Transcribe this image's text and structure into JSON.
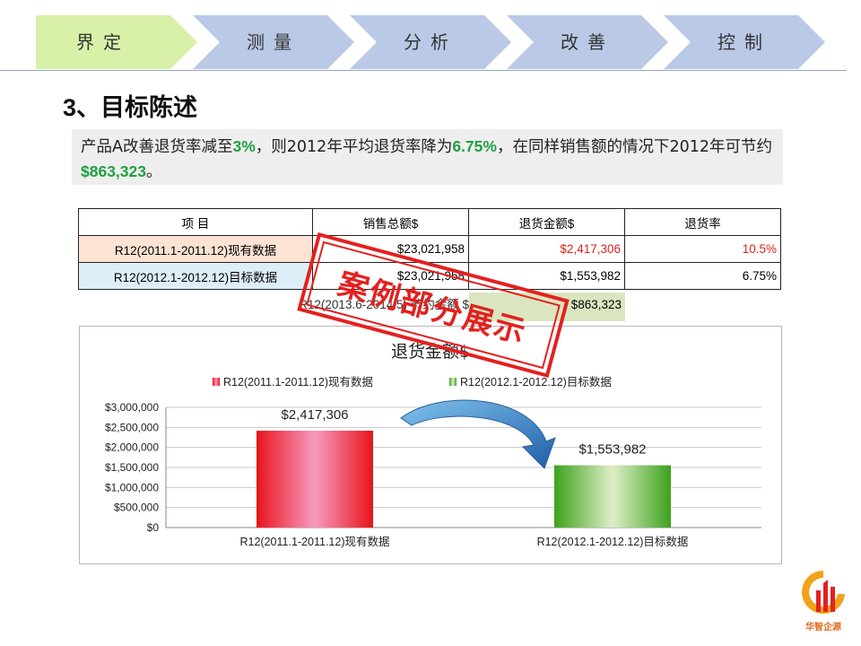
{
  "nav": {
    "steps": [
      "界定",
      "测量",
      "分析",
      "改善",
      "控制"
    ],
    "active_index": 0
  },
  "title": {
    "number": "3",
    "sep": "、",
    "text": "目标陈述"
  },
  "summary": {
    "t1": "产品A改善退货率减至",
    "v1": "3%",
    "t2": "，则2012年平均退货率降为",
    "v2": "6.75%",
    "t3": "，在同样销售额的情况下2012年可节约 ",
    "v3": "$863,323",
    "t4": "。"
  },
  "table": {
    "headers": [
      "项 目",
      "销售总额$",
      "退货金额$",
      "退货率"
    ],
    "rows": [
      {
        "label": "R12(2011.1-2011.12)现有数据",
        "sales": "$23,021,958",
        "returns": "$2,417,306",
        "rate": "10.5%"
      },
      {
        "label": "R12(2012.1-2012.12)目标数据",
        "sales": "$23,021,958",
        "returns": "$1,553,982",
        "rate": "6.75%"
      }
    ],
    "savings_label": "R12(2013.6-2014.5) 节约金额 $",
    "savings_value": "$863,323"
  },
  "stamp": {
    "text": "案例部分展示"
  },
  "logo": {
    "text": "华智企源"
  },
  "colors": {
    "nav_active": "#d8f0a8",
    "nav_inactive": "#b9c9e6",
    "green_highlight": "#21a045",
    "red_value": "#e0201a",
    "stamp": "#e3211f"
  },
  "chart_data": {
    "type": "bar",
    "title": "退货金额$",
    "categories": [
      "R12(2011.1-2011.12)现有数据",
      "R12(2012.1-2012.12)目标数据"
    ],
    "values": [
      2417306,
      1553982
    ],
    "data_labels": [
      "$2,417,306",
      "$1,553,982"
    ],
    "legend": [
      "R12(2011.1-2011.12)现有数据",
      "R12(2012.1-2012.12)目标数据"
    ],
    "legend_position": "top",
    "ylim": [
      0,
      3000000
    ],
    "yticks": [
      "$0",
      "$500,000",
      "$1,000,000",
      "$1,500,000",
      "$2,000,000",
      "$2,500,000",
      "$3,000,000"
    ],
    "grid": true,
    "colors": [
      "#e8141a",
      "#5cb82e"
    ]
  }
}
